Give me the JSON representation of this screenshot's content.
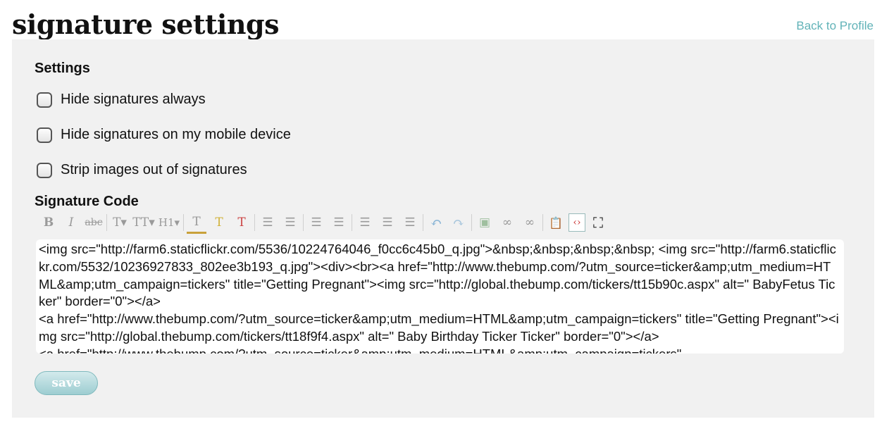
{
  "header": {
    "title": "signature settings",
    "back_link": "Back to Profile"
  },
  "settings": {
    "heading": "Settings",
    "options": [
      {
        "label": "Hide signatures always",
        "checked": false
      },
      {
        "label": "Hide signatures on my mobile device",
        "checked": false
      },
      {
        "label": "Strip images out of signatures",
        "checked": false
      }
    ]
  },
  "signature": {
    "heading": "Signature Code",
    "toolbar": [
      {
        "icon": "bold-icon",
        "glyph": "B"
      },
      {
        "icon": "italic-icon",
        "glyph": "I"
      },
      {
        "icon": "strikethrough-icon",
        "glyph": "abc"
      },
      {
        "icon": "font-face-icon",
        "glyph": "T▾"
      },
      {
        "icon": "font-size-icon",
        "glyph": "TT▾"
      },
      {
        "icon": "heading-icon",
        "glyph": "H1▾"
      },
      {
        "icon": "text-color-icon",
        "glyph": "T"
      },
      {
        "icon": "highlight-icon",
        "glyph": "T"
      },
      {
        "icon": "remove-format-icon",
        "glyph": "T"
      },
      {
        "icon": "bullet-list-icon",
        "glyph": "☰"
      },
      {
        "icon": "numbered-list-icon",
        "glyph": "☰"
      },
      {
        "icon": "outdent-icon",
        "glyph": "☰"
      },
      {
        "icon": "indent-icon",
        "glyph": "☰"
      },
      {
        "icon": "align-left-icon",
        "glyph": "☰"
      },
      {
        "icon": "align-center-icon",
        "glyph": "☰"
      },
      {
        "icon": "align-right-icon",
        "glyph": "☰"
      },
      {
        "icon": "undo-icon",
        "glyph": "↶"
      },
      {
        "icon": "redo-icon",
        "glyph": "↷"
      },
      {
        "icon": "image-icon",
        "glyph": "▣"
      },
      {
        "icon": "link-icon",
        "glyph": "∞"
      },
      {
        "icon": "unlink-icon",
        "glyph": "∞"
      },
      {
        "icon": "paste-text-icon",
        "glyph": "📋"
      },
      {
        "icon": "source-code-icon",
        "glyph": "‹›"
      },
      {
        "icon": "fullscreen-icon",
        "glyph": "⛶"
      }
    ],
    "code": "<img src=\"http://farm6.staticflickr.com/5536/10224764046_f0cc6c45b0_q.jpg\">&nbsp;&nbsp;&nbsp;&nbsp; <img src=\"http://farm6.staticflickr.com/5532/10236927833_802ee3b193_q.jpg\"><div><br><a href=\"http://www.thebump.com/?utm_source=ticker&amp;utm_medium=HTML&amp;utm_campaign=tickers\" title=\"Getting Pregnant\"><img src=\"http://global.thebump.com/tickers/tt15b90c.aspx\" alt=\" BabyFetus Ticker\" border=\"0\"></a>\n<a href=\"http://www.thebump.com/?utm_source=ticker&amp;utm_medium=HTML&amp;utm_campaign=tickers\" title=\"Getting Pregnant\"><img src=\"http://global.thebump.com/tickers/tt18f9f4.aspx\" alt=\" Baby Birthday Ticker Ticker\" border=\"0\"></a>\n<a href=\"http://www.thebump.com/?utm_source=ticker&amp;utm_medium=HTML&amp;utm_campaign=tickers\""
  },
  "actions": {
    "save_label": "save"
  }
}
